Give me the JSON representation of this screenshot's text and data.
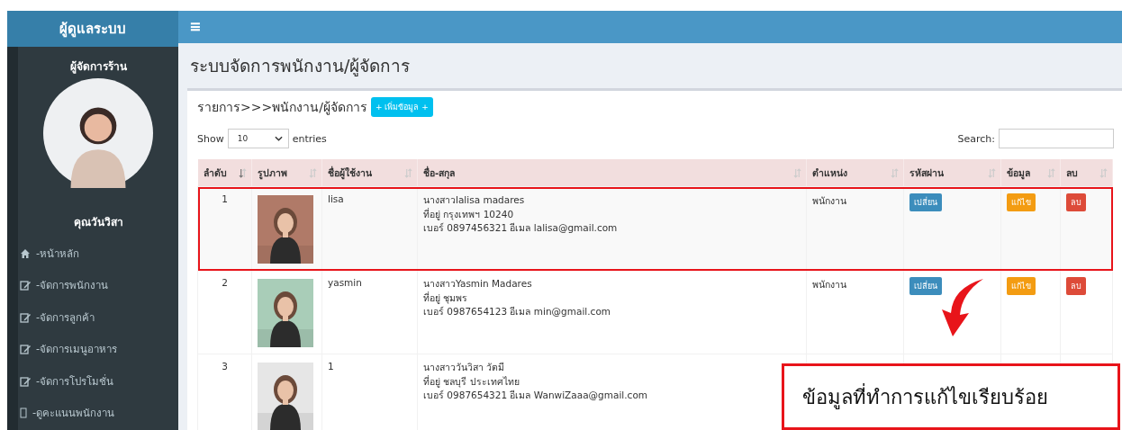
{
  "sidebar": {
    "brand": "ผู้ดูแลระบบ",
    "role": "ผู้จัดการร้าน",
    "user_name": "คุณวันวิสา",
    "items": [
      {
        "label": "-หน้าหลัก",
        "kind": "home"
      },
      {
        "label": "-จัดการพนักงาน",
        "kind": "edit"
      },
      {
        "label": "-จัดการลูกค้า",
        "kind": "edit"
      },
      {
        "label": "-จัดการเมนูอาหาร",
        "kind": "edit"
      },
      {
        "label": "-จัดการโปรโมชั่น",
        "kind": "edit"
      },
      {
        "label": "-ดูคะแนนพนักงาน",
        "kind": "box"
      }
    ]
  },
  "header": {
    "menu_icon": "≡"
  },
  "page_title": "ระบบจัดการพนักงาน/ผู้จัดการ",
  "breadcrumb": "รายการ>>>พนักงาน/ผู้จัดการ",
  "add_button": "+ เพิ่มข้อมูล +",
  "length_menu": {
    "before": "Show",
    "value": "10",
    "after": "entries"
  },
  "search": {
    "label": "Search:"
  },
  "table": {
    "columns": [
      {
        "label": "ลำดับ",
        "sorted": true
      },
      {
        "label": "รูปภาพ",
        "sorted": false
      },
      {
        "label": "ชื่อผู้ใช้งาน",
        "sorted": false
      },
      {
        "label": "ชื่อ-สกุล",
        "sorted": false
      },
      {
        "label": "ตำแหน่ง",
        "sorted": false
      },
      {
        "label": "รหัสผ่าน",
        "sorted": false
      },
      {
        "label": "ข้อมูล",
        "sorted": false
      },
      {
        "label": "ลบ",
        "sorted": false
      }
    ],
    "rows": [
      {
        "no": "1",
        "username": "lisa",
        "name_lines": [
          "นางสาวlalisa madares",
          "ที่อยู่ กรุงเทพฯ 10240",
          "เบอร์ 0897456321 อีเมล lalisa@gmail.com"
        ],
        "position": "พนักงาน",
        "change_button": "เปลี่ยน",
        "edit_button": "แก้ไข",
        "delete_button": "ลบ",
        "highlighted": true
      },
      {
        "no": "2",
        "username": "yasmin",
        "name_lines": [
          "นางสาวYasmin Madares",
          "ที่อยู่ ชุมพร",
          "เบอร์ 0987654123 อีเมล min@gmail.com"
        ],
        "position": "พนักงาน",
        "change_button": "เปลี่ยน",
        "edit_button": "แก้ไข",
        "delete_button": "ลบ",
        "highlighted": false
      },
      {
        "no": "3",
        "username": "1",
        "name_lines": [
          "นางสาววันวิสา วัตมี",
          "ที่อยู่ ชลบุรี ประเทศไทย",
          "เบอร์ 0987654321 อีเมล WanwiZaaa@gmail.com"
        ],
        "highlighted": false
      }
    ]
  },
  "callout": {
    "text": "ข้อมูลที่ทำการแก้ไขเรียบร้อย"
  }
}
